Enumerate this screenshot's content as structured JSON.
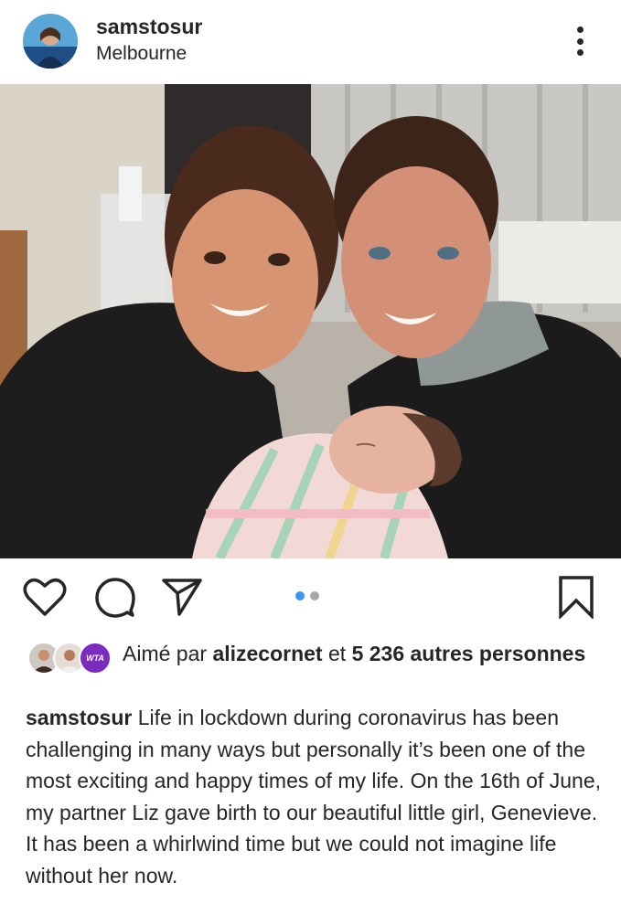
{
  "post": {
    "username": "samstosur",
    "location": "Melbourne",
    "photo_description": "",
    "carousel": {
      "total": 2,
      "active": 1
    }
  },
  "actions": {
    "like_icon": "heart-icon",
    "comment_icon": "comment-icon",
    "share_icon": "send-icon",
    "save_icon": "bookmark-icon"
  },
  "likes": {
    "prefix": "Aimé par",
    "first_liker": "alizecornet",
    "conjunction": "et",
    "others": "5 236 autres personnes",
    "liker_badge_text": "WTA"
  },
  "caption": {
    "username": "samstosur",
    "text": "Life in lockdown during coronavirus has been challenging in many ways but personally it’s been one of the most exciting and happy times of my life.  On the 16th of June, my partner Liz gave birth to our beautiful little girl, Genevieve. It has been a whirlwind time but we could not imagine life without her now."
  },
  "colors": {
    "text": "#262626",
    "accent_dot": "#3897f0",
    "inactive_dot": "#a8a8a8",
    "wta_purple": "#7b2cbf"
  }
}
